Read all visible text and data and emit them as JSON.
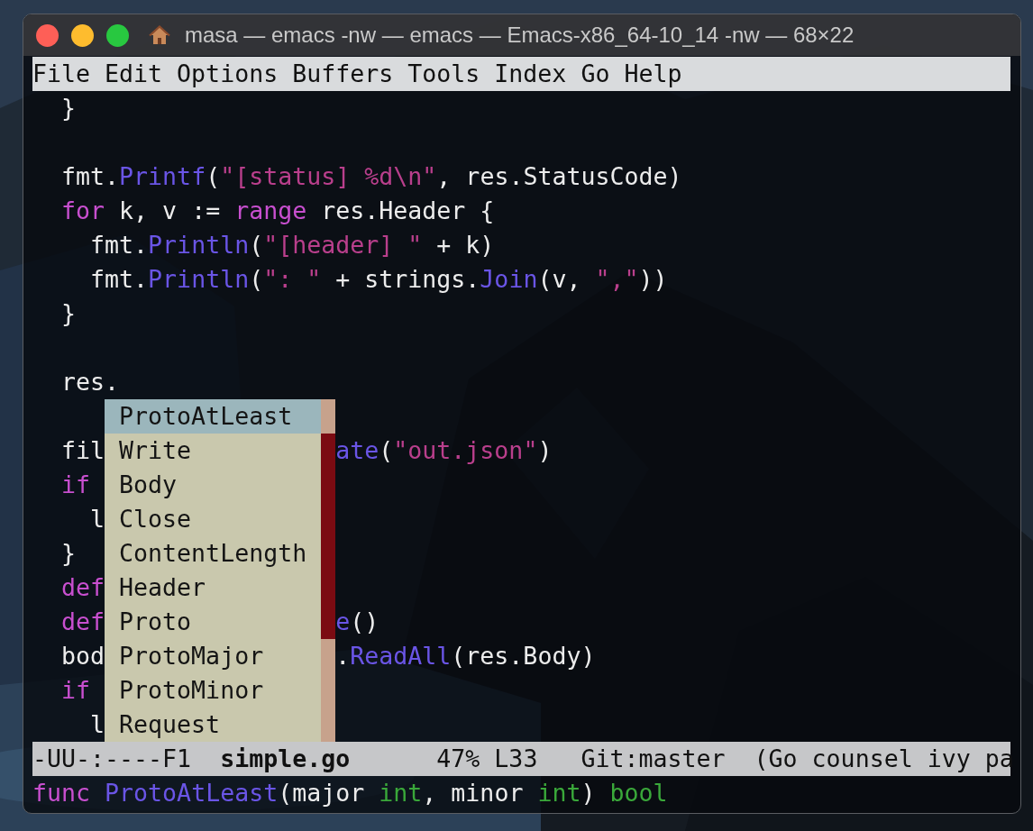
{
  "window": {
    "title": "masa — emacs -nw — emacs — Emacs-x86_64-10_14 -nw — 68×22"
  },
  "menu_bar": [
    "File",
    "Edit",
    "Options",
    "Buffers",
    "Tools",
    "Index",
    "Go",
    "Help"
  ],
  "editor": {
    "lines": [
      {
        "kind": "code",
        "tokens": [
          {
            "text": "  }",
            "kind": "plain"
          }
        ]
      },
      {
        "kind": "blank"
      },
      {
        "kind": "code",
        "tokens": [
          {
            "text": "  fmt.",
            "kind": "plain"
          },
          {
            "text": "Printf",
            "kind": "function"
          },
          {
            "text": "(",
            "kind": "plain"
          },
          {
            "text": "\"[status] %d\\n\"",
            "kind": "string"
          },
          {
            "text": ", res.StatusCode)",
            "kind": "plain"
          }
        ]
      },
      {
        "kind": "code",
        "tokens": [
          {
            "text": "  for",
            "kind": "keyword"
          },
          {
            "text": " k, v := ",
            "kind": "plain"
          },
          {
            "text": "range",
            "kind": "keyword"
          },
          {
            "text": " res.Header {",
            "kind": "plain"
          }
        ]
      },
      {
        "kind": "code",
        "tokens": [
          {
            "text": "    fmt.",
            "kind": "plain"
          },
          {
            "text": "Println",
            "kind": "function"
          },
          {
            "text": "(",
            "kind": "plain"
          },
          {
            "text": "\"[header] \"",
            "kind": "string"
          },
          {
            "text": " + k)",
            "kind": "plain"
          }
        ]
      },
      {
        "kind": "code",
        "tokens": [
          {
            "text": "    fmt.",
            "kind": "plain"
          },
          {
            "text": "Println",
            "kind": "function"
          },
          {
            "text": "(",
            "kind": "plain"
          },
          {
            "text": "\": \"",
            "kind": "string"
          },
          {
            "text": " + strings.",
            "kind": "plain"
          },
          {
            "text": "Join",
            "kind": "function"
          },
          {
            "text": "(v, ",
            "kind": "plain"
          },
          {
            "text": "\",\"",
            "kind": "string"
          },
          {
            "text": "))",
            "kind": "plain"
          }
        ]
      },
      {
        "kind": "code",
        "tokens": [
          {
            "text": "  }",
            "kind": "plain"
          }
        ]
      },
      {
        "kind": "blank"
      },
      {
        "kind": "code",
        "tokens": [
          {
            "text": "  res.",
            "kind": "plain"
          }
        ]
      },
      {
        "kind": "blank"
      },
      {
        "kind": "code",
        "tokens": [
          {
            "text": "  fil",
            "kind": "plain"
          }
        ],
        "after_popup": [
          {
            "text": "ate",
            "kind": "function"
          },
          {
            "text": "(",
            "kind": "plain"
          },
          {
            "text": "\"out.json\"",
            "kind": "string"
          },
          {
            "text": ")",
            "kind": "plain"
          }
        ]
      },
      {
        "kind": "code",
        "tokens": [
          {
            "text": "  if",
            "kind": "keyword"
          }
        ]
      },
      {
        "kind": "code",
        "tokens": [
          {
            "text": "    l",
            "kind": "plain"
          }
        ]
      },
      {
        "kind": "code",
        "tokens": [
          {
            "text": "  }",
            "kind": "plain"
          }
        ]
      },
      {
        "kind": "code",
        "tokens": [
          {
            "text": "  def",
            "kind": "keyword"
          }
        ]
      },
      {
        "kind": "code",
        "tokens": [
          {
            "text": "  def",
            "kind": "keyword"
          }
        ],
        "after_popup": [
          {
            "text": "e",
            "kind": "function"
          },
          {
            "text": "()",
            "kind": "plain"
          }
        ]
      },
      {
        "kind": "code",
        "tokens": [
          {
            "text": "  bod",
            "kind": "plain"
          }
        ],
        "after_popup": [
          {
            "text": ".",
            "kind": "plain"
          },
          {
            "text": "ReadAll",
            "kind": "function"
          },
          {
            "text": "(res.Body)",
            "kind": "plain"
          }
        ]
      },
      {
        "kind": "code",
        "tokens": [
          {
            "text": "  if",
            "kind": "keyword"
          }
        ]
      },
      {
        "kind": "code",
        "tokens": [
          {
            "text": "    l",
            "kind": "plain"
          }
        ]
      }
    ]
  },
  "completion_popup": {
    "items": [
      {
        "label": "ProtoAtLeast",
        "selected": true
      },
      {
        "label": "Write",
        "selected": false
      },
      {
        "label": "Body",
        "selected": false
      },
      {
        "label": "Close",
        "selected": false
      },
      {
        "label": "ContentLength",
        "selected": false
      },
      {
        "label": "Header",
        "selected": false
      },
      {
        "label": "Proto",
        "selected": false
      },
      {
        "label": "ProtoMajor",
        "selected": false
      },
      {
        "label": "ProtoMinor",
        "selected": false
      },
      {
        "label": "Request",
        "selected": false
      }
    ]
  },
  "mode_line": [
    {
      "text": "-UU-:----F1  ",
      "bold": false
    },
    {
      "text": "simple.go",
      "bold": true
    },
    {
      "text": "      47% L33   Git:master  (Go counsel ivy pa",
      "bold": false
    }
  ],
  "echo_area": {
    "tokens": [
      {
        "text": "func ",
        "kind": "keyword"
      },
      {
        "text": "ProtoAtLeast",
        "kind": "function"
      },
      {
        "text": "(major ",
        "kind": "plain"
      },
      {
        "text": "int",
        "kind": "type"
      },
      {
        "text": ", minor ",
        "kind": "plain"
      },
      {
        "text": "int",
        "kind": "type"
      },
      {
        "text": ") ",
        "kind": "plain"
      },
      {
        "text": "bool",
        "kind": "type"
      }
    ]
  }
}
